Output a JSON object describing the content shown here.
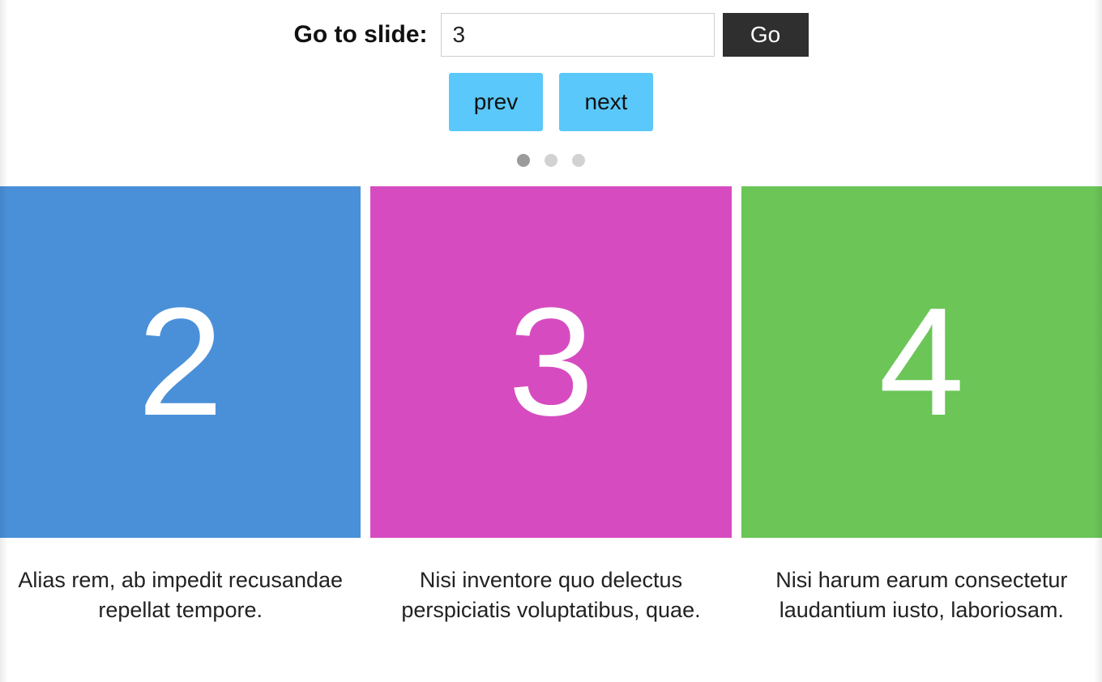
{
  "goto": {
    "label": "Go to slide:",
    "value": "3",
    "button": "Go"
  },
  "nav": {
    "prev": "prev",
    "next": "next"
  },
  "dots": {
    "count": 3,
    "activeIndex": 0
  },
  "slides": [
    {
      "number": "2",
      "bg": "#4a90d9",
      "caption": "Alias rem, ab impedit recusandae repellat tempore."
    },
    {
      "number": "3",
      "bg": "#d64cc0",
      "caption": "Nisi inventore quo delectus perspiciatis voluptatibus, quae."
    },
    {
      "number": "4",
      "bg": "#6bc557",
      "caption": "Nisi harum earum consectetur laudantium iusto, laboriosam."
    }
  ]
}
